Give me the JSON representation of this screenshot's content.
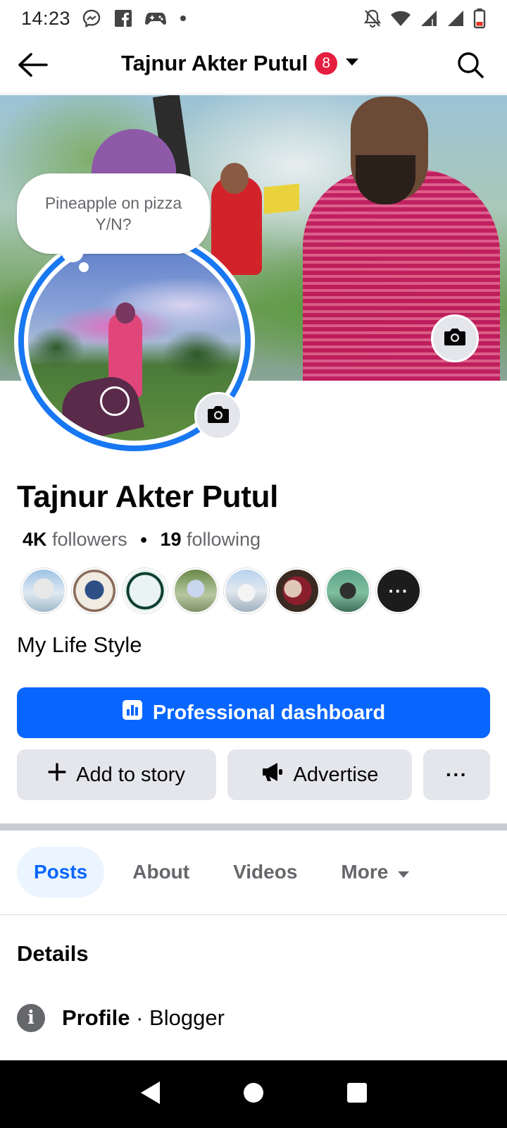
{
  "status_bar": {
    "time": "14:23",
    "left_icons": [
      "messenger-icon",
      "facebook-icon",
      "gamepad-icon",
      "dot-icon"
    ],
    "right_icons": [
      "bell-off-icon",
      "wifi-icon",
      "signal-icon",
      "signal-icon",
      "battery-icon"
    ]
  },
  "app_bar": {
    "title": "Tajnur Akter Putul",
    "badge_count": "8",
    "back_icon": "arrow-left-icon",
    "search_icon": "search-icon",
    "dropdown_icon": "caret-down-icon"
  },
  "profile": {
    "note_bubble": "Pineapple on pizza\nY/N?",
    "name": "Tajnur Akter Putul",
    "followers_count": "4K",
    "followers_label": "followers",
    "following_count": "19",
    "following_label": "following",
    "more_friends": "···",
    "bio": "My Life Style"
  },
  "actions": {
    "professional_dashboard": "Professional dashboard",
    "add_to_story": "Add to story",
    "advertise": "Advertise",
    "more_options": "···"
  },
  "tabs": [
    {
      "label": "Posts",
      "active": true
    },
    {
      "label": "About",
      "active": false
    },
    {
      "label": "Videos",
      "active": false
    },
    {
      "label": "More",
      "active": false
    }
  ],
  "details": {
    "heading": "Details",
    "profile_label": "Profile",
    "separator": "·",
    "profile_value": "Blogger"
  },
  "colors": {
    "primary": "#0866ff",
    "badge": "#e41e3f",
    "ring": "#1877f2",
    "secondary_bg": "#e4e6eb"
  }
}
